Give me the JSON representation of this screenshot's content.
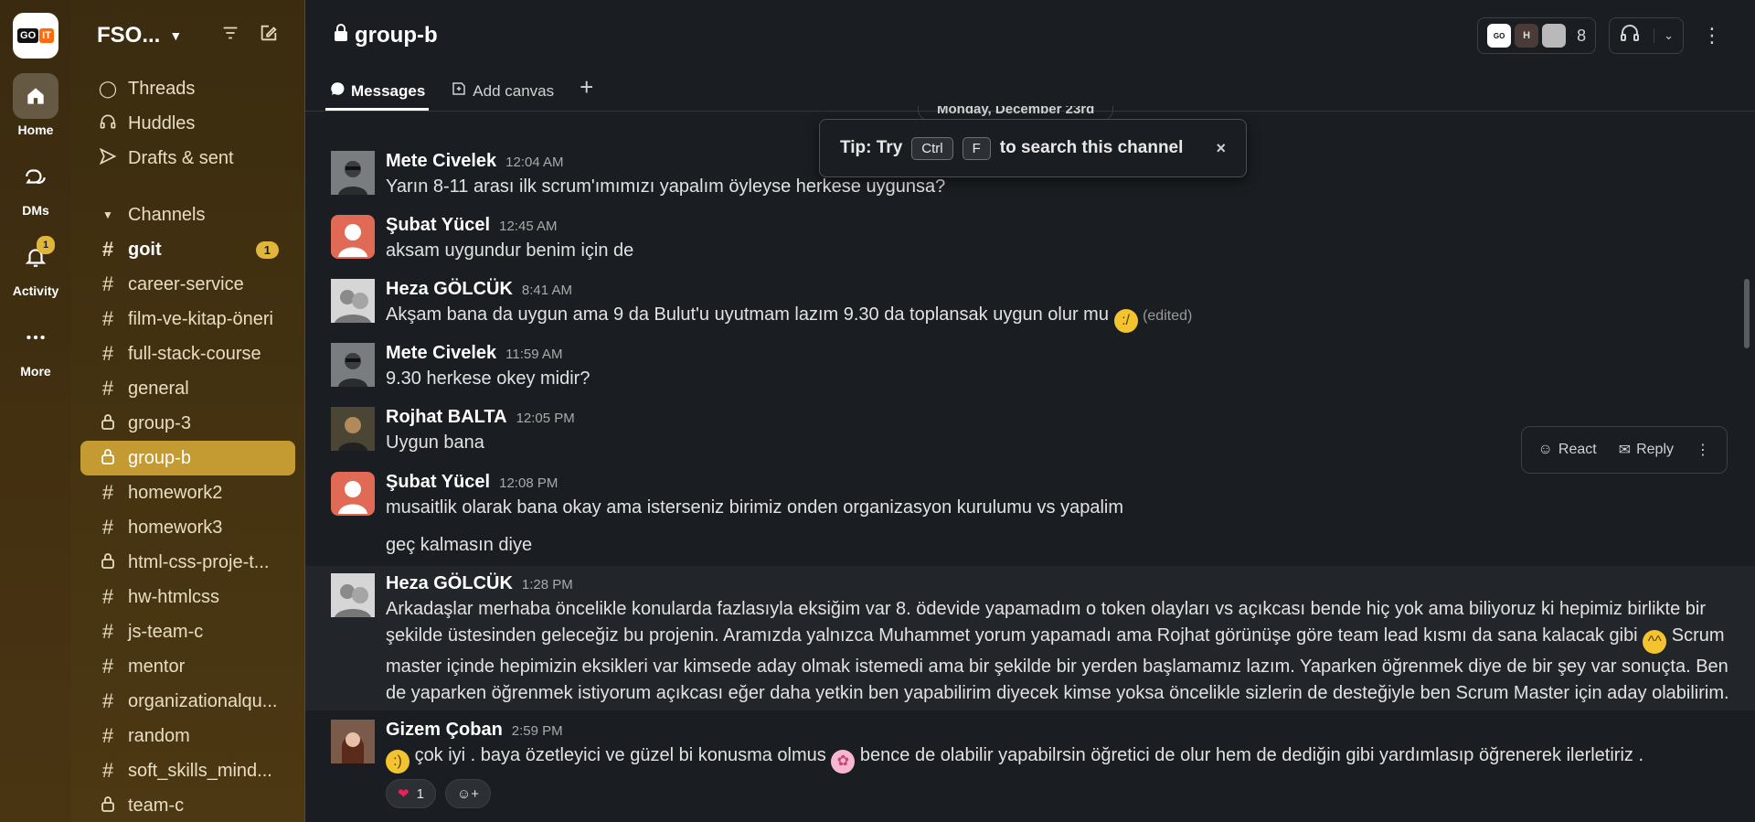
{
  "workspace": {
    "name": "FSO...",
    "logo_left": "GO",
    "logo_right": "IT"
  },
  "rail": {
    "items": [
      {
        "label": "Home",
        "icon": "home-icon"
      },
      {
        "label": "DMs",
        "icon": "dms-icon"
      },
      {
        "label": "Activity",
        "icon": "bell-icon",
        "badge": "1"
      },
      {
        "label": "More",
        "icon": "more-icon"
      }
    ]
  },
  "sidebar": {
    "nav": [
      {
        "label": "Threads",
        "icon": "threads-icon"
      },
      {
        "label": "Huddles",
        "icon": "headphones-icon"
      },
      {
        "label": "Drafts & sent",
        "icon": "send-icon"
      }
    ],
    "channels_label": "Channels",
    "channels": [
      {
        "name": "goit",
        "type": "public",
        "bold": true,
        "badge": "1"
      },
      {
        "name": "career-service",
        "type": "public"
      },
      {
        "name": "film-ve-kitap-öneri",
        "type": "public"
      },
      {
        "name": "full-stack-course",
        "type": "public"
      },
      {
        "name": "general",
        "type": "public"
      },
      {
        "name": "group-3",
        "type": "private"
      },
      {
        "name": "group-b",
        "type": "private",
        "selected": true
      },
      {
        "name": "homework2",
        "type": "public"
      },
      {
        "name": "homework3",
        "type": "public"
      },
      {
        "name": "html-css-proje-t...",
        "type": "private"
      },
      {
        "name": "hw-htmlcss",
        "type": "public"
      },
      {
        "name": "js-team-c",
        "type": "public"
      },
      {
        "name": "mentor",
        "type": "public"
      },
      {
        "name": "organizationalqu...",
        "type": "public"
      },
      {
        "name": "random",
        "type": "public"
      },
      {
        "name": "soft_skills_mind...",
        "type": "public"
      },
      {
        "name": "team-c",
        "type": "private"
      }
    ]
  },
  "header": {
    "channel_name": "group-b",
    "member_count": "8",
    "member_initial": "H",
    "tabs": [
      {
        "label": "Messages",
        "active": true
      },
      {
        "label": "Add canvas"
      },
      {
        "label": "+"
      }
    ]
  },
  "date_divider": "Monday, December 23rd",
  "tip": {
    "prefix": "Tip: Try",
    "key1": "Ctrl",
    "key2": "F",
    "suffix": "to search this channel",
    "close": "×"
  },
  "hover_actions": {
    "react": "React",
    "reply": "Reply"
  },
  "messages": [
    {
      "author": "Mete Civelek",
      "time": "12:04 AM",
      "lines": [
        "Yarın 8-11 arası ilk scrum'ımımızı yapalım öyleyse herkese uygunsa?"
      ]
    },
    {
      "author": "Şubat Yücel",
      "time": "12:45 AM",
      "lines": [
        "aksam uygundur benim için de"
      ]
    },
    {
      "author": "Heza GÖLCÜK",
      "time": "8:41 AM",
      "text": "Akşam bana da uygun ama 9 da Bulut'u uyutmam lazım 9.30 da toplansak uygun olur mu",
      "edited": "(edited)"
    },
    {
      "author": "Mete Civelek",
      "time": "11:59 AM",
      "lines": [
        "9.30 herkese okey midir?"
      ]
    },
    {
      "author": "Rojhat BALTA",
      "time": "12:05 PM",
      "lines": [
        "Uygun bana"
      ]
    },
    {
      "author": "Şubat Yücel",
      "time": "12:08 PM",
      "lines": [
        "musaitlik olarak bana okay ama isterseniz birimiz onden organizasyon kurulumu vs yapalim"
      ],
      "followup": "geç kalmasın diye"
    },
    {
      "author": "Heza GÖLCÜK",
      "time": "1:28 PM",
      "text_a": "Arkadaşlar merhaba öncelikle konularda fazlasıyla eksiğim var 8. ödevide yapamadım o token olayları vs açıkcası bende hiç yok ama biliyoruz ki hepimiz birlikte bir şekilde üstesinden geleceğiz bu projenin. Aramızda yalnızca Muhammet yorum yapamadı ama Rojhat görünüşe göre team lead kısmı da sana kalacak gibi",
      "text_b": "Scrum master içinde hepimizin eksikleri var kimsede aday olmak istemedi ama bir şekilde bir yerden başlamamız lazım. Yaparken öğrenmek diye de bir şey var sonuçta. Ben de yaparken öğrenmek istiyorum açıkcası eğer daha yetkin ben yapabilirim diyecek kimse yoksa öncelikle sizlerin de desteğiyle ben Scrum Master için aday olabilirim."
    },
    {
      "author": "Gizem Çoban",
      "time": "2:59 PM",
      "text_a": "çok iyi . baya özetleyici ve güzel bi konusma olmus",
      "text_b": "bence de olabilir yapabilrsin öğretici de olur hem de dediğin gibi yardımlasıp öğrenerek ilerletiriz .",
      "reaction_count": "1"
    }
  ]
}
